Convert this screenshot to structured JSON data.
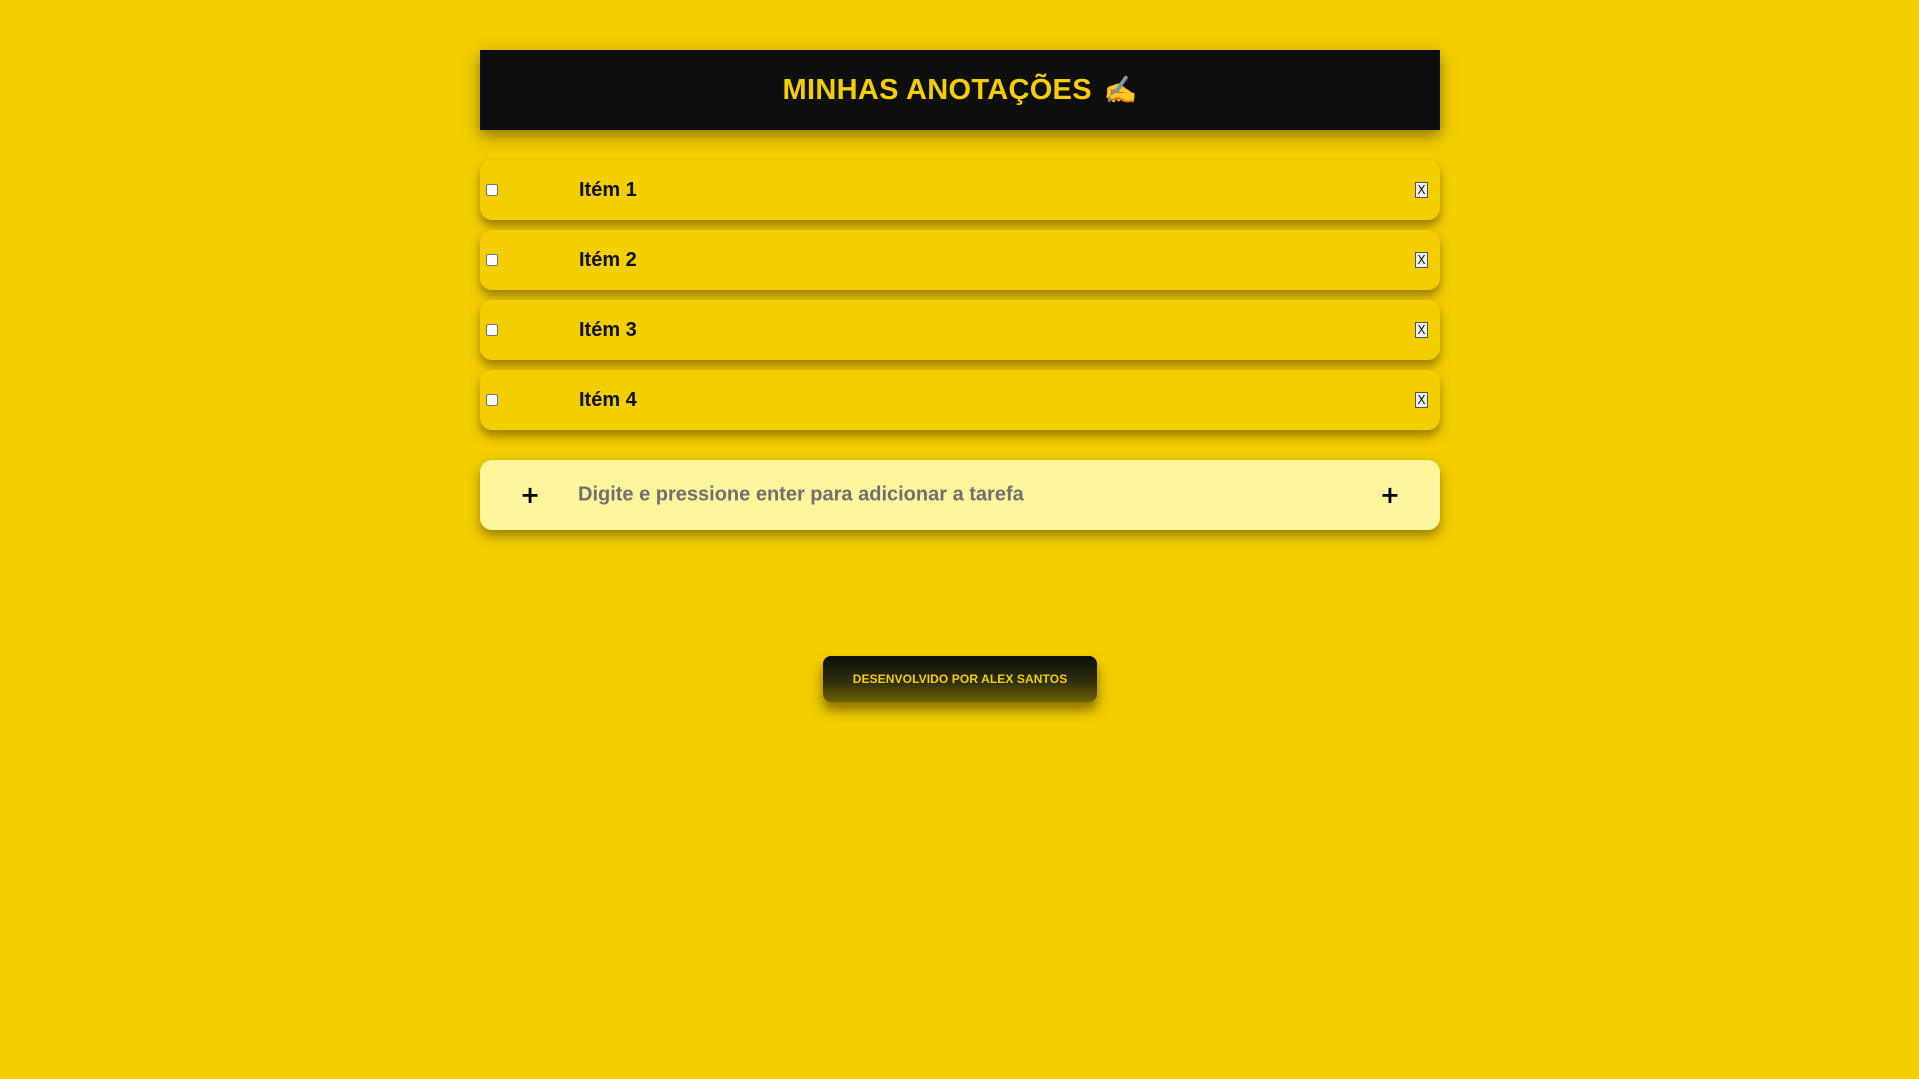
{
  "header": {
    "title": "MINHAS ANOTAÇÕES",
    "emoji": "✍️"
  },
  "items": [
    {
      "label": "Itém 1",
      "checked": false,
      "delete_label": "X"
    },
    {
      "label": "Itém 2",
      "checked": false,
      "delete_label": "X"
    },
    {
      "label": "Itém 3",
      "checked": false,
      "delete_label": "X"
    },
    {
      "label": "Itém 4",
      "checked": false,
      "delete_label": "X"
    }
  ],
  "add_task": {
    "placeholder": "Digite e pressione enter para adicionar a tarefa",
    "value": "",
    "left_icon": "+",
    "right_icon": "+"
  },
  "footer": {
    "credit": "DESENVOLVIDO POR ALEX SANTOS"
  },
  "colors": {
    "background": "#f3ce00",
    "header_bg": "#0e0e0c",
    "accent": "#f3ce00",
    "input_bg": "#fff59d"
  }
}
